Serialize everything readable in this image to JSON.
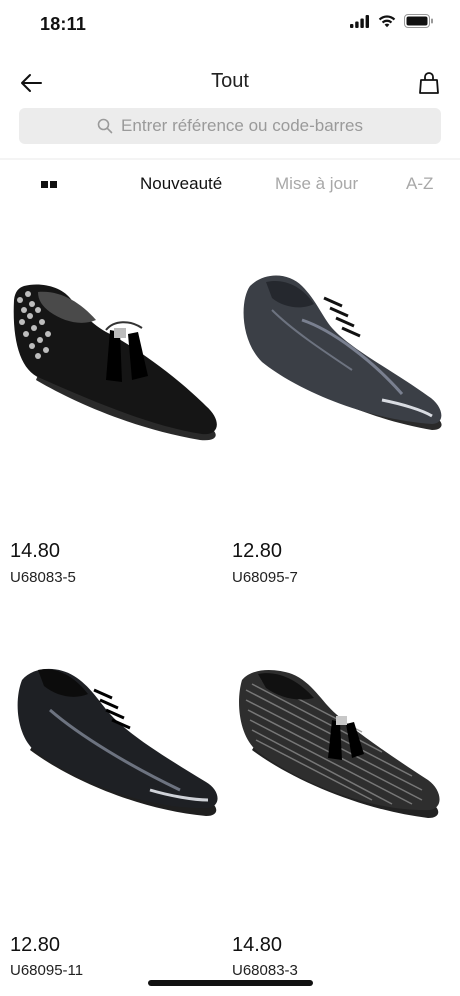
{
  "status": {
    "time": "18:11"
  },
  "header": {
    "title": "Tout"
  },
  "search": {
    "placeholder": "Entrer référence ou code-barres"
  },
  "sort": {
    "tabs": [
      "Nouveauté",
      "Mise à jour",
      "A-Z"
    ],
    "active": 0
  },
  "products": [
    {
      "price": "14.80",
      "ref": "U68083-5",
      "image": "black-suede-loafer-with-spikes-and-tassel"
    },
    {
      "price": "12.80",
      "ref": "U68095-7",
      "image": "grey-patent-oxford-shoe"
    },
    {
      "price": "12.80",
      "ref": "U68095-11",
      "image": "black-patent-oxford-shoe"
    },
    {
      "price": "14.80",
      "ref": "U68083-3",
      "image": "striped-tassel-loafer"
    }
  ],
  "colors": {
    "accent": "#111111",
    "muted": "#a8a8a8",
    "search_bg": "#ececec"
  }
}
